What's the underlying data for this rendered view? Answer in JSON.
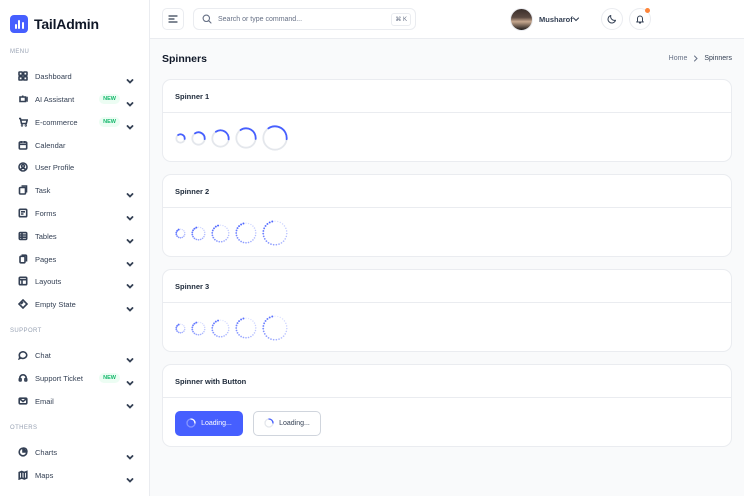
{
  "brand": {
    "name": "TailAdmin",
    "accent": "#465fff"
  },
  "sidebar": {
    "sections": [
      {
        "label": "MENU"
      },
      {
        "label": "SUPPORT"
      },
      {
        "label": "OTHERS"
      }
    ],
    "items": [
      {
        "label": "Dashboard",
        "icon": "grid-icon",
        "badge": "",
        "chevron": true
      },
      {
        "label": "AI Assistant",
        "icon": "ai-icon",
        "badge": "NEW",
        "chevron": true
      },
      {
        "label": "E-commerce",
        "icon": "cart-icon",
        "badge": "NEW",
        "chevron": true
      },
      {
        "label": "Calendar",
        "icon": "calendar-icon",
        "badge": "",
        "chevron": false
      },
      {
        "label": "User Profile",
        "icon": "user-circle-icon",
        "badge": "",
        "chevron": false
      },
      {
        "label": "Task",
        "icon": "task-icon",
        "badge": "",
        "chevron": true
      },
      {
        "label": "Forms",
        "icon": "forms-icon",
        "badge": "",
        "chevron": true
      },
      {
        "label": "Tables",
        "icon": "table-icon",
        "badge": "",
        "chevron": true
      },
      {
        "label": "Pages",
        "icon": "pages-icon",
        "badge": "",
        "chevron": true
      },
      {
        "label": "Layouts",
        "icon": "layout-icon",
        "badge": "",
        "chevron": true
      },
      {
        "label": "Empty State",
        "icon": "empty-state-icon",
        "badge": "",
        "chevron": true
      },
      {
        "label": "Chat",
        "icon": "chat-icon",
        "badge": "",
        "chevron": true
      },
      {
        "label": "Support Ticket",
        "icon": "headset-icon",
        "badge": "NEW",
        "chevron": true
      },
      {
        "label": "Email",
        "icon": "mail-icon",
        "badge": "",
        "chevron": true
      },
      {
        "label": "Charts",
        "icon": "pie-chart-icon",
        "badge": "",
        "chevron": true
      },
      {
        "label": "Maps",
        "icon": "map-icon",
        "badge": "",
        "chevron": true
      }
    ]
  },
  "header": {
    "search_placeholder": "Search or type command...",
    "search_shortcut": "⌘ K",
    "user_name": "Musharof"
  },
  "page": {
    "title": "Spinners",
    "breadcrumb_home": "Home",
    "breadcrumb_current": "Spinners"
  },
  "cards": [
    {
      "title": "Spinner 1",
      "style": "arc"
    },
    {
      "title": "Spinner 2",
      "style": "dots"
    },
    {
      "title": "Spinner 3",
      "style": "dots-faint"
    },
    {
      "title": "Spinner with Button",
      "style": "buttons"
    }
  ],
  "buttons": {
    "primary_label": "Loading...",
    "secondary_label": "Loading..."
  },
  "colors": {
    "accent": "#465fff",
    "track": "#e4e7ec",
    "badge_green": "#12b76a"
  }
}
